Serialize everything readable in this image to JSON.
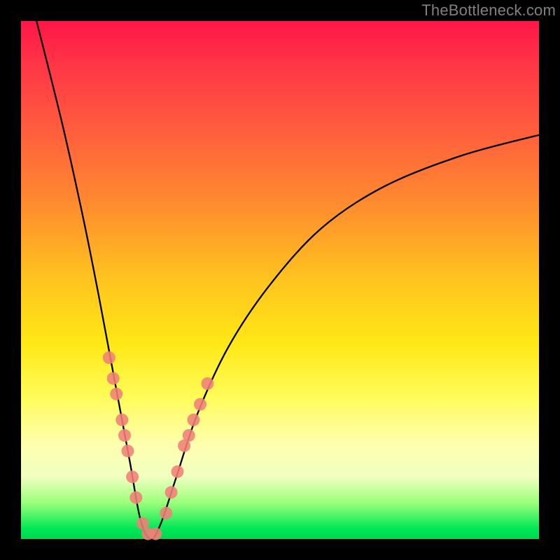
{
  "watermark": "TheBottleneck.com",
  "colors": {
    "background": "#000000",
    "gradient_top": "#ff1648",
    "gradient_bottom": "#00d84f",
    "curve": "#000000",
    "markers": "#f08078"
  },
  "chart_data": {
    "type": "line",
    "title": "",
    "xlabel": "",
    "ylabel": "",
    "xlim": [
      0,
      100
    ],
    "ylim": [
      0,
      100
    ],
    "curve": {
      "left_top_x": 3,
      "left_top_y": 100,
      "apex_x": 25,
      "apex_y": 0,
      "right_end_x": 100,
      "right_end_y": 78
    },
    "curve_points": [
      {
        "x": 3,
        "y": 100
      },
      {
        "x": 8,
        "y": 80
      },
      {
        "x": 12,
        "y": 62
      },
      {
        "x": 15,
        "y": 47
      },
      {
        "x": 18,
        "y": 31
      },
      {
        "x": 21,
        "y": 15
      },
      {
        "x": 23,
        "y": 4
      },
      {
        "x": 25,
        "y": 0
      },
      {
        "x": 27,
        "y": 3
      },
      {
        "x": 30,
        "y": 12
      },
      {
        "x": 34,
        "y": 24
      },
      {
        "x": 40,
        "y": 37
      },
      {
        "x": 48,
        "y": 49
      },
      {
        "x": 58,
        "y": 60
      },
      {
        "x": 70,
        "y": 68
      },
      {
        "x": 85,
        "y": 74
      },
      {
        "x": 100,
        "y": 78
      }
    ],
    "markers_left": [
      {
        "x": 17.0,
        "y": 35
      },
      {
        "x": 17.8,
        "y": 31
      },
      {
        "x": 18.4,
        "y": 28
      },
      {
        "x": 19.5,
        "y": 23
      },
      {
        "x": 20.0,
        "y": 20
      },
      {
        "x": 20.6,
        "y": 17
      },
      {
        "x": 21.5,
        "y": 12
      },
      {
        "x": 22.2,
        "y": 8
      },
      {
        "x": 23.5,
        "y": 3
      },
      {
        "x": 24.5,
        "y": 1
      },
      {
        "x": 26.0,
        "y": 1
      }
    ],
    "markers_right": [
      {
        "x": 28.0,
        "y": 5
      },
      {
        "x": 29.0,
        "y": 9
      },
      {
        "x": 30.2,
        "y": 13
      },
      {
        "x": 31.5,
        "y": 18
      },
      {
        "x": 32.4,
        "y": 20
      },
      {
        "x": 33.3,
        "y": 23
      },
      {
        "x": 34.6,
        "y": 26
      },
      {
        "x": 36.0,
        "y": 30
      }
    ]
  }
}
